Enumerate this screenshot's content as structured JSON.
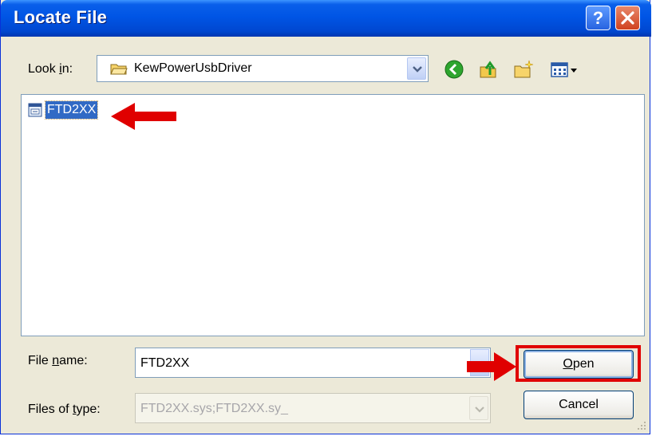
{
  "window": {
    "title": "Locate File",
    "help_symbol": "?"
  },
  "lookin": {
    "label_prefix": "Look ",
    "label_accel": "i",
    "label_suffix": "n:",
    "value": "KewPowerUsbDriver"
  },
  "files": [
    {
      "name": "FTD2XX",
      "selected": true
    }
  ],
  "filename": {
    "label_prefix": "File ",
    "label_accel": "n",
    "label_suffix": "ame:",
    "value": "FTD2XX"
  },
  "filetype": {
    "label_prefix": "Files of ",
    "label_accel": "t",
    "label_suffix": "ype:",
    "value": "FTD2XX.sys;FTD2XX.sy_"
  },
  "buttons": {
    "open_accel": "O",
    "open_rest": "pen",
    "cancel": "Cancel"
  },
  "colors": {
    "annotation": "#E00000",
    "selection": "#316AC5",
    "titlebar": "#0055E5"
  }
}
